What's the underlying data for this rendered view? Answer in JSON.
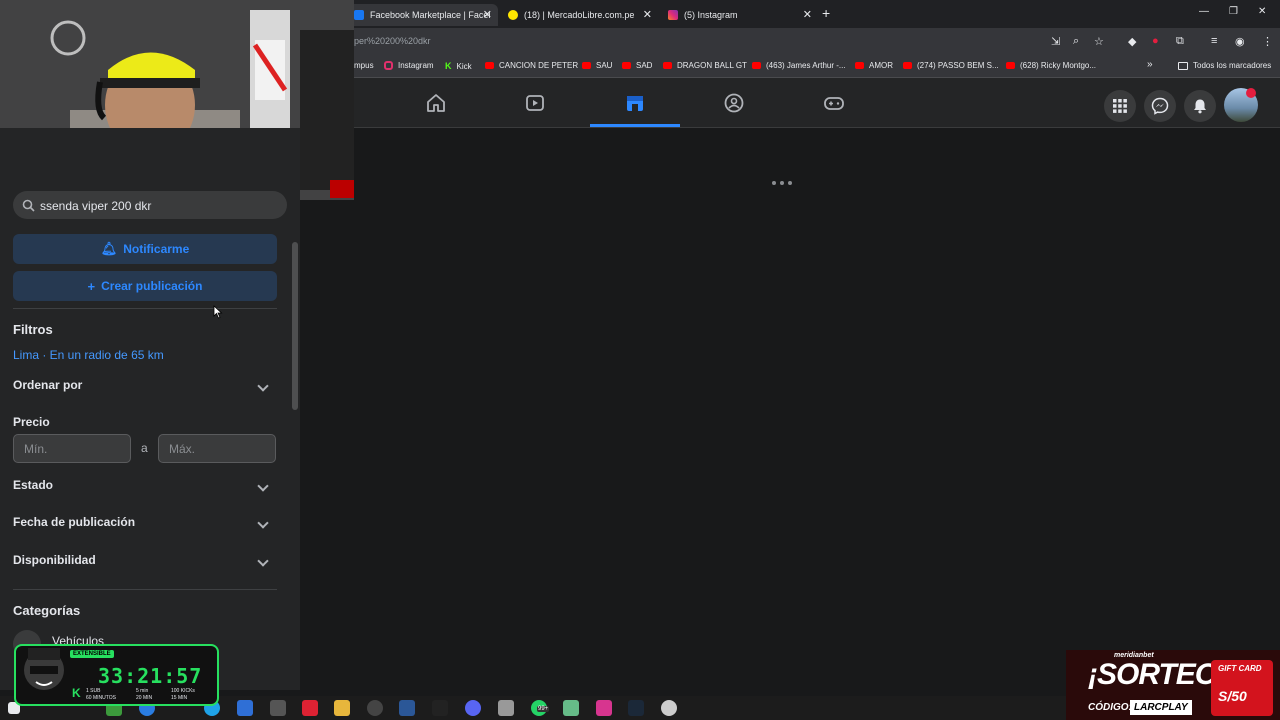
{
  "browser": {
    "tabs": [
      {
        "title": "Facebook Marketplace | Facebo",
        "active": true
      },
      {
        "title": "(18) | MercadoLibre.com.pe",
        "active": false
      },
      {
        "title": "(5) Instagram",
        "active": false
      }
    ],
    "url": "per%20200%20dkr",
    "bookmarks": [
      {
        "label": "mpus",
        "icon": "none"
      },
      {
        "label": "Instagram",
        "icon": "instagram-icon"
      },
      {
        "label": "Kick",
        "icon": "kick-icon"
      },
      {
        "label": "CANCION DE PETER",
        "icon": "youtube-icon"
      },
      {
        "label": "SAU",
        "icon": "youtube-icon"
      },
      {
        "label": "SAD",
        "icon": "youtube-icon"
      },
      {
        "label": "DRAGON BALL GT",
        "icon": "youtube-icon"
      },
      {
        "label": "(463) James Arthur -...",
        "icon": "youtube-icon"
      },
      {
        "label": "AMOR",
        "icon": "youtube-icon"
      },
      {
        "label": "(274) PASSO BEM S...",
        "icon": "youtube-icon"
      },
      {
        "label": "(628) Ricky Montgo...",
        "icon": "youtube-icon"
      }
    ],
    "bookmarks_overflow": "»",
    "all_bookmarks": "Todos los marcadores"
  },
  "sidebar": {
    "search_value": "ssenda viper 200 dkr",
    "notify_label": "Notificarme",
    "create_label": "Crear publicación",
    "filters_heading": "Filtros",
    "location": "Lima · En un radio de 65 km",
    "sort_label": "Ordenar por",
    "price_label": "Precio",
    "min_placeholder": "Mín.",
    "price_sep": "a",
    "max_placeholder": "Máx.",
    "condition_label": "Estado",
    "date_label": "Fecha de publicación",
    "availability_label": "Disponibilidad",
    "categories_heading": "Categorías",
    "category_vehicles": "Vehículos"
  },
  "timer": {
    "value": "33:21:57",
    "badge": "EXTENSIBLE",
    "sub1": "1 SUB",
    "sub1b": "60 MINUTOS",
    "sub2": "5 min",
    "sub2b": "20 MIN",
    "sub3": "100 KICKs",
    "sub3b": "15 MIN"
  },
  "promo": {
    "brand": "meridianbet",
    "title": "¡SORTEO!",
    "code_label": "CÓDIGO:",
    "code": "LARCPLAY",
    "card_label": "GIFT CARD",
    "card_value": "S/50"
  },
  "taskbar": {
    "badge": "99+"
  },
  "colors": {
    "fb_blue": "#2d88ff",
    "bg_dark": "#18191a",
    "panel": "#242526",
    "timer_green": "#27e05f"
  }
}
